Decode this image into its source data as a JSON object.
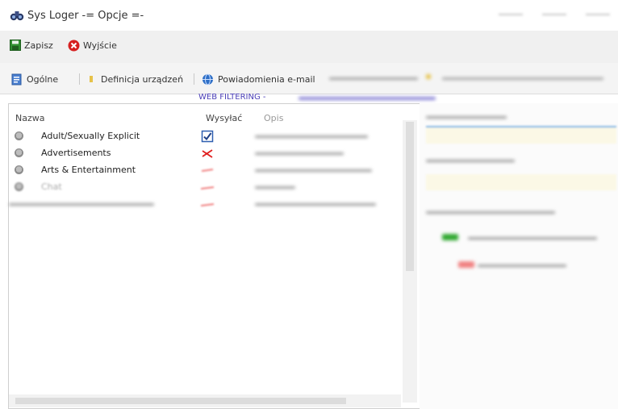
{
  "window": {
    "title": "Sys Loger -= Opcje =-"
  },
  "toolbar": {
    "save_label": "Zapisz",
    "exit_label": "Wyjście"
  },
  "tabs": [
    {
      "label": "Ogólne"
    },
    {
      "label": "Definicja urządzeń"
    },
    {
      "label": "Powiadomienia e-mail"
    }
  ],
  "section": {
    "title": "WEB FILTERING - "
  },
  "table": {
    "columns": {
      "name": "Nazwa",
      "send": "Wysyłać",
      "description": "Opis"
    },
    "rows": [
      {
        "name": "Adult/Sexually Explicit",
        "send": "checked"
      },
      {
        "name": "Advertisements",
        "send": "cross"
      },
      {
        "name": "Arts & Entertainment",
        "send": "cross"
      },
      {
        "name": "Chat",
        "send": "cross"
      },
      {
        "name": "",
        "send": "cross"
      }
    ]
  },
  "colors": {
    "accent_blue": "#2e6fc7",
    "cross_red": "#e02020",
    "section_purple": "#4a3fb8",
    "ok_green": "#2fa82f"
  },
  "icons": {
    "app": "binoculars-icon",
    "save": "floppy-disk-icon",
    "exit": "red-x-circle-icon",
    "general": "document-icon",
    "devices": "device-definition-icon",
    "email": "globe-mail-icon",
    "checked": "checkbox-checked-icon",
    "cross": "red-cross-icon"
  }
}
